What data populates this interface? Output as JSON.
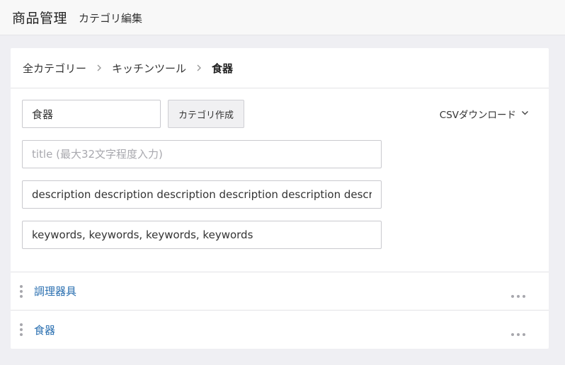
{
  "header": {
    "app_title": "商品管理",
    "page_subtitle": "カテゴリ編集"
  },
  "breadcrumb": {
    "items": [
      "全カテゴリー",
      "キッチンツール",
      "食器"
    ]
  },
  "form": {
    "category_name_value": "食器",
    "create_button_label": "カテゴリ作成",
    "csv_download_label": "CSVダウンロード",
    "title_placeholder": "title (最大32文字程度入力)",
    "title_value": "",
    "description_value": "description description description description description descr",
    "keywords_value": "keywords, keywords, keywords, keywords"
  },
  "categories": [
    {
      "label": "調理器具"
    },
    {
      "label": "食器"
    }
  ],
  "colors": {
    "link": "#2a6fb0",
    "background": "#efeff3"
  }
}
